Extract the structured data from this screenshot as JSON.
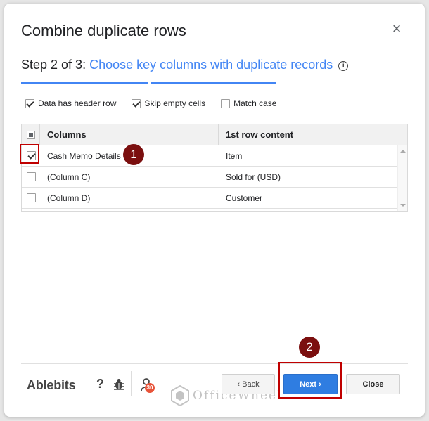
{
  "dialog": {
    "title": "Combine duplicate rows",
    "step_prefix": "Step 2 of 3: ",
    "step_title": "Choose key columns with duplicate records",
    "info_glyph": "i"
  },
  "options": [
    {
      "label": "Data has header row",
      "checked": true
    },
    {
      "label": "Skip empty cells",
      "checked": true
    },
    {
      "label": "Match case",
      "checked": false
    }
  ],
  "table": {
    "headers": [
      "Columns",
      "1st row content"
    ],
    "rows": [
      {
        "column": "Cash Memo Details",
        "content": "Item",
        "checked": true
      },
      {
        "column": "(Column C)",
        "content": "Sold for (USD)",
        "checked": false
      },
      {
        "column": "(Column D)",
        "content": "Customer",
        "checked": false
      }
    ]
  },
  "annotations": {
    "badge1": "1",
    "badge2": "2",
    "highlight_color": "#c00000",
    "badge_color": "#7b0f0f"
  },
  "footer": {
    "brand": "Ablebits",
    "help": "?",
    "account_badge": "30",
    "watermark": "OfficeWheel",
    "back_label": "‹ Back",
    "next_label": "Next ›",
    "close_label": "Close"
  },
  "colors": {
    "accent": "#4285f4",
    "next_button": "#2f7de1"
  }
}
